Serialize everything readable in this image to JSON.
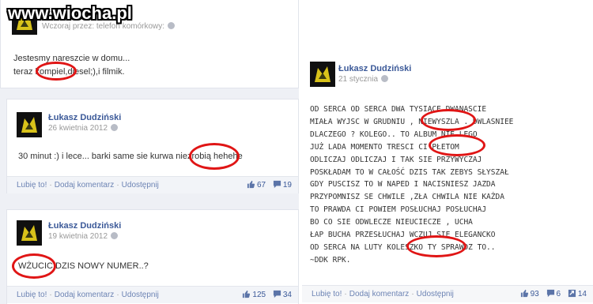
{
  "watermark": "www.wiocha.pl",
  "post_top": {
    "meta": "Wczoraj przez: telefon komórkowy:",
    "line1": "Jestesmy nareszcie w domu...",
    "line2": "teraz kompiel,diesel;),i filmik."
  },
  "post_mid": {
    "author": "Łukasz Dudziński",
    "date": "26 kwietnia 2012",
    "text": "30 minut :) i lece... barki same sie kurwa niezrobią hehehe",
    "actions": {
      "like": "Lubię to!",
      "comment": "Dodaj komentarz",
      "share": "Udostępnij"
    },
    "likes": "67",
    "comments": "19"
  },
  "post_bottom": {
    "author": "Łukasz Dudziński",
    "date": "19 kwietnia 2012",
    "text": "WŻUCIC DZIS NOWY NUMER..?",
    "actions": {
      "like": "Lubię to!",
      "comment": "Dodaj komentarz",
      "share": "Udostępnij"
    },
    "likes": "125",
    "comments": "34"
  },
  "post_right": {
    "author": "Łukasz Dudziński",
    "date": "21 stycznia",
    "lines": [
      "OD SERCA OD SERCA DWA TYSIĄCE DWANASCIE",
      "MIAŁA WYJSC W GRUDNIU , NIEWYSZLA . DWLASNIEE",
      "DLACZEGO ? KOLEGO.. TO ALBUM NIE LEGO",
      "JUŻ LADA MOMENTO TRESCI CI PŁETOM",
      "ODLICZAJ ODLICZAJ I TAK SIE PRZYWYCZAJ",
      "POSKŁADAM TO W CAŁOŚĆ DZIS TAK ZEBYS SŁYSZAŁ",
      "GDY PUSCISZ TO W NAPED I NACISNIESZ JAZDA",
      "PRZYPOMNISZ SE CHWILE ,ZŁA CHWILA NIE KAŻDA",
      "TO PRAWDA CI POWIEM POSŁUCHAJ POSŁUCHAJ",
      "BO CO SIE ODWLECZE NIEUCIECZE , UCHA",
      "ŁAP BUCHA PRZESŁUCHAJ WCZUJ SIE ELEGANCKO",
      "OD SERCA NA LUTY KOLESZKO TY SPRAWDZ TO..",
      "~DDK RPK."
    ],
    "actions": {
      "like": "Lubię to!",
      "comment": "Dodaj komentarz",
      "share": "Udostępnij"
    },
    "likes": "93",
    "comments": "6",
    "shares": "14"
  },
  "colors": {
    "link": "#3b5998",
    "highlight": "#e01515",
    "band": "#eef0f5"
  },
  "icons": [
    "thumbs-up-icon",
    "comment-icon",
    "share-icon",
    "globe-icon",
    "avatar-wolf"
  ]
}
